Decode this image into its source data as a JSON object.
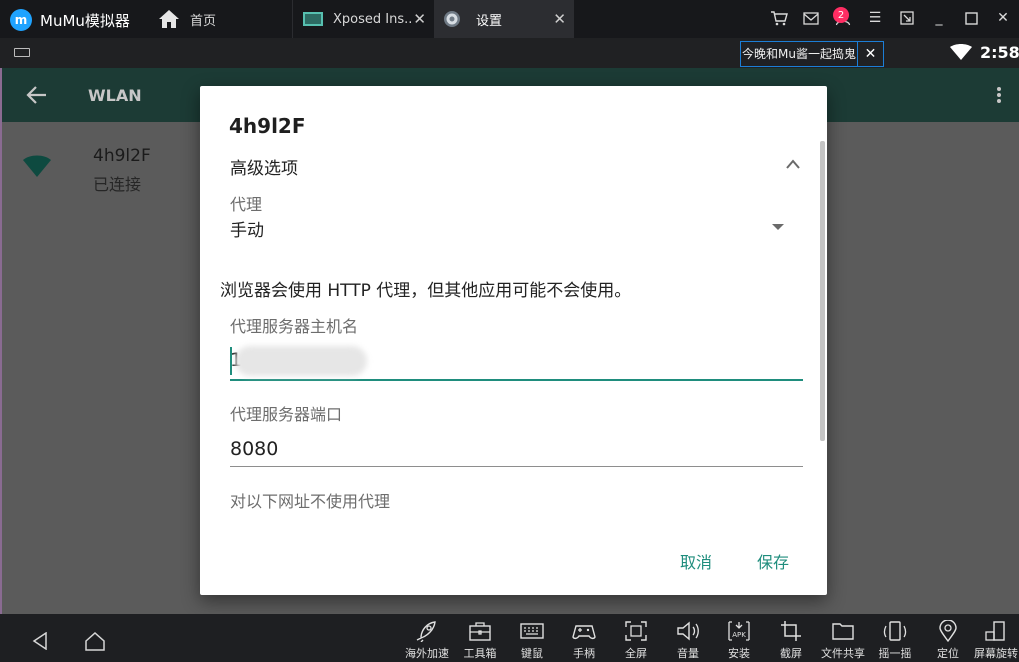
{
  "window": {
    "app_title": "MuMu模拟器",
    "tabs": [
      {
        "label": "首页"
      },
      {
        "label": "Xposed Ins.."
      },
      {
        "label": "设置"
      }
    ],
    "message_badge": "2",
    "notice": "今晚和Mu酱一起捣鬼",
    "clock": "2:58"
  },
  "android": {
    "appbar_title": "WLAN",
    "network_name": "4h9l2F",
    "network_status": "已连接"
  },
  "dialog": {
    "title": "4h9l2F",
    "advanced": "高级选项",
    "proxy_label": "代理",
    "proxy_value": "手动",
    "note": "浏览器会使用 HTTP 代理，但其他应用可能不会使用。",
    "host_label": "代理服务器主机名",
    "host_value": "1",
    "port_label": "代理服务器端口",
    "port_value": "8080",
    "bypass_label": "对以下网址不使用代理",
    "cancel": "取消",
    "save": "保存"
  },
  "dock": {
    "tools": [
      {
        "label": "海外加速",
        "icon": "rocket-icon"
      },
      {
        "label": "工具箱",
        "icon": "toolbox-icon"
      },
      {
        "label": "键鼠",
        "icon": "keyboard-icon"
      },
      {
        "label": "手柄",
        "icon": "gamepad-icon"
      },
      {
        "label": "全屏",
        "icon": "fullscreen-icon"
      },
      {
        "label": "音量",
        "icon": "volume-icon"
      },
      {
        "label": "安装",
        "icon": "apk-icon"
      },
      {
        "label": "截屏",
        "icon": "crop-icon"
      },
      {
        "label": "文件共享",
        "icon": "folder-icon"
      },
      {
        "label": "摇一摇",
        "icon": "shake-icon"
      },
      {
        "label": "定位",
        "icon": "location-icon"
      },
      {
        "label": "屏幕旋转",
        "icon": "rotate-icon"
      }
    ]
  },
  "colors": {
    "accent": "#1f8d7d",
    "titlebar": "#17181b",
    "appbar": "#1c3b35",
    "scrim": "#5b5b5b",
    "badge": "#ff2d63",
    "notice_border": "#1c7ed6"
  }
}
